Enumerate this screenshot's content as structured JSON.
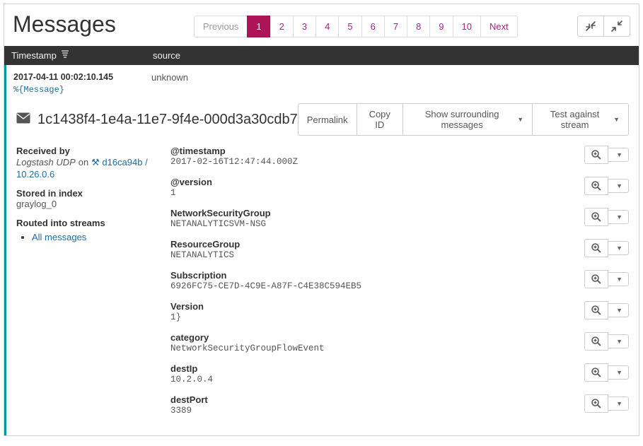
{
  "title": "Messages",
  "pagination": {
    "previous": "Previous",
    "pages": [
      "1",
      "2",
      "3",
      "4",
      "5",
      "6",
      "7",
      "8",
      "9",
      "10"
    ],
    "next": "Next",
    "active": "1"
  },
  "columns": {
    "timestamp": "Timestamp",
    "source": "source"
  },
  "message": {
    "timestamp": "2017-04-11 00:02:10.145",
    "template": "%{Message}",
    "source": "unknown",
    "id": "1c1438f4-1e4a-11e7-9f4e-000d3a30cdb7"
  },
  "actions": {
    "permalink": "Permalink",
    "copy_id": "Copy ID",
    "surrounding": "Show surrounding messages",
    "test_stream": "Test against stream"
  },
  "meta": {
    "received_by": "Received by",
    "input_name": "Logstash UDP",
    "on": "on",
    "node_link": "d16ca94b / 10.26.0.6",
    "stored_in": "Stored in index",
    "index_name": "graylog_0",
    "routed": "Routed into streams",
    "stream_link": "All messages"
  },
  "fields": [
    {
      "key": "@timestamp",
      "value": "2017-02-16T12:47:44.000Z"
    },
    {
      "key": "@version",
      "value": "1"
    },
    {
      "key": "NetworkSecurityGroup",
      "value": "NETANALYTICSVM-NSG"
    },
    {
      "key": "ResourceGroup",
      "value": "NETANALYTICS"
    },
    {
      "key": "Subscription",
      "value": "6926FC75-CE7D-4C9E-A87F-C4E38C594EB5"
    },
    {
      "key": "Version",
      "value": "1}"
    },
    {
      "key": "category",
      "value": "NetworkSecurityGroupFlowEvent"
    },
    {
      "key": "destIp",
      "value": "10.2.0.4"
    },
    {
      "key": "destPort",
      "value": "3389"
    }
  ]
}
